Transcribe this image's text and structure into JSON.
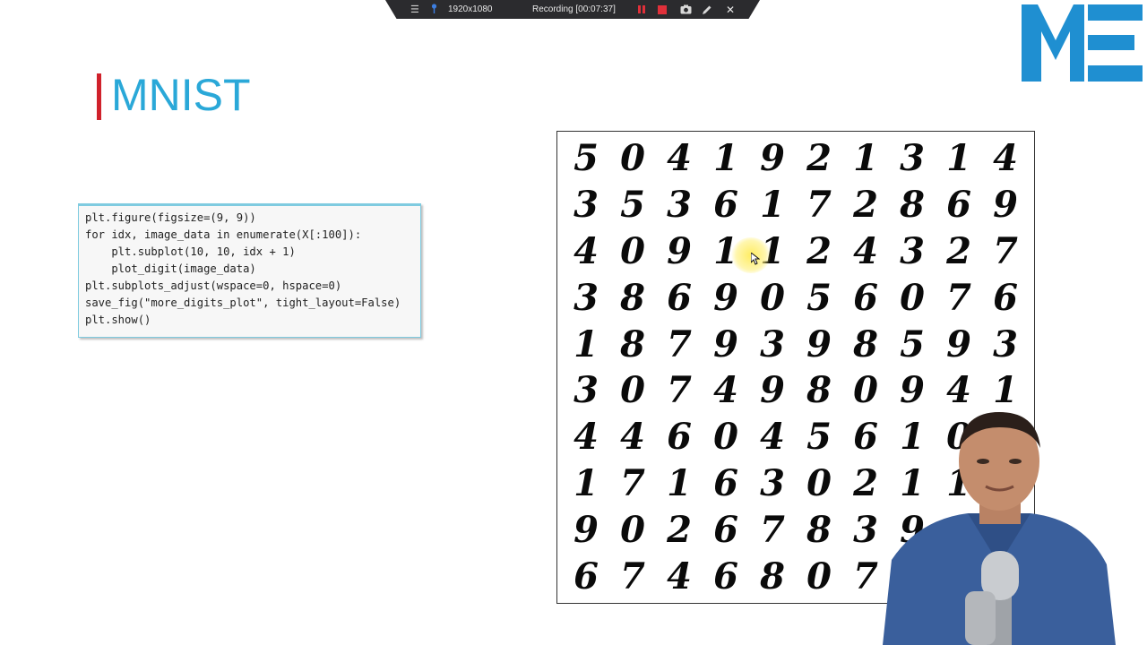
{
  "recorder": {
    "resolution": "1920x1080",
    "status": "Recording [00:07:37]"
  },
  "logo": {
    "text": "ME",
    "color": "#1f8fd1"
  },
  "slide": {
    "title": "MNIST",
    "title_color": "#2aa8d8",
    "accent_color": "#d0212b"
  },
  "code": {
    "lines": [
      "plt.figure(figsize=(9, 9))",
      "for idx, image_data in enumerate(X[:100]):",
      "    plt.subplot(10, 10, idx + 1)",
      "    plot_digit(image_data)",
      "plt.subplots_adjust(wspace=0, hspace=0)",
      "save_fig(\"more_digits_plot\", tight_layout=False)",
      "plt.show()"
    ]
  },
  "digits": {
    "rows": [
      [
        "5",
        "0",
        "4",
        "1",
        "9",
        "2",
        "1",
        "3",
        "1",
        "4"
      ],
      [
        "3",
        "5",
        "3",
        "6",
        "1",
        "7",
        "2",
        "8",
        "6",
        "9"
      ],
      [
        "4",
        "0",
        "9",
        "1",
        "1",
        "2",
        "4",
        "3",
        "2",
        "7"
      ],
      [
        "3",
        "8",
        "6",
        "9",
        "0",
        "5",
        "6",
        "0",
        "7",
        "6"
      ],
      [
        "1",
        "8",
        "7",
        "9",
        "3",
        "9",
        "8",
        "5",
        "9",
        "3"
      ],
      [
        "3",
        "0",
        "7",
        "4",
        "9",
        "8",
        "0",
        "9",
        "4",
        "1"
      ],
      [
        "4",
        "4",
        "6",
        "0",
        "4",
        "5",
        "6",
        "1",
        "0",
        ""
      ],
      [
        "1",
        "7",
        "1",
        "6",
        "3",
        "0",
        "2",
        "1",
        "1",
        ""
      ],
      [
        "9",
        "0",
        "2",
        "6",
        "7",
        "8",
        "3",
        "9",
        "0",
        ""
      ],
      [
        "6",
        "7",
        "4",
        "6",
        "8",
        "0",
        "7",
        "",
        "",
        ""
      ]
    ]
  }
}
